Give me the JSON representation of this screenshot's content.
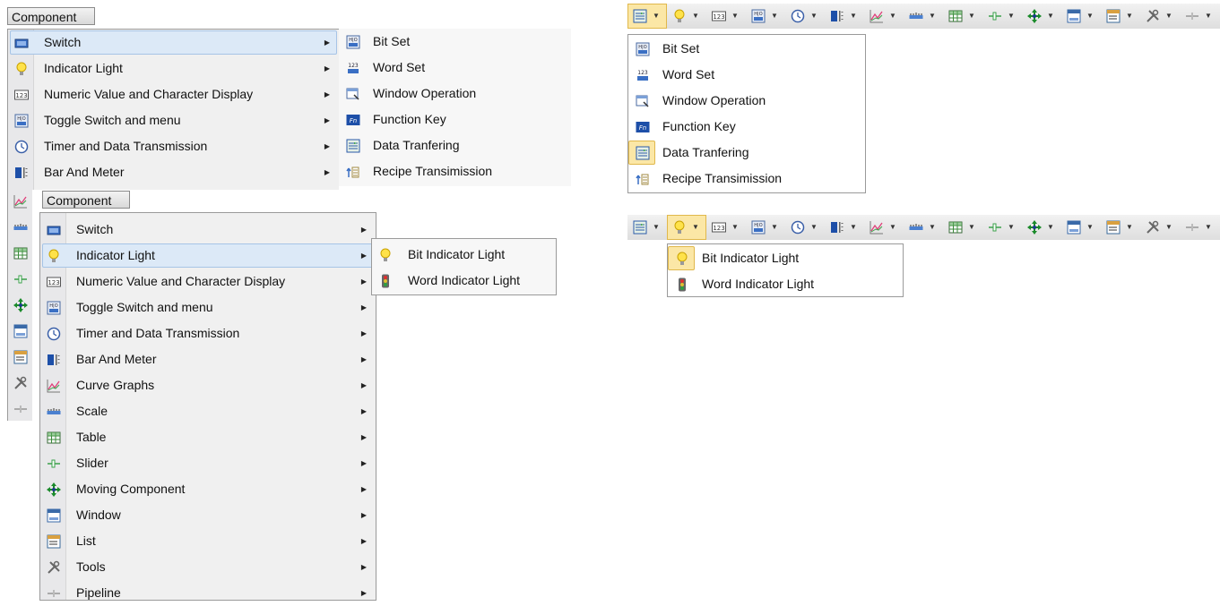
{
  "left_menu_1": {
    "title": "Component",
    "items": [
      {
        "label": "Switch",
        "icon": "switch-icon"
      },
      {
        "label": "Indicator Light",
        "icon": "bulb-icon"
      },
      {
        "label": "Numeric Value and Character Display",
        "icon": "numeric-icon"
      },
      {
        "label": "Toggle Switch and menu",
        "icon": "toggle-icon"
      },
      {
        "label": "Timer and Data Transmission",
        "icon": "clock-icon"
      },
      {
        "label": "Bar And Meter",
        "icon": "bar-meter-icon"
      }
    ],
    "gutter_icons_extra": [
      "curve-icon",
      "scale-icon",
      "table-icon",
      "slider-icon",
      "moving-icon",
      "window-icon",
      "list-icon",
      "tools-icon",
      "pipeline-icon"
    ],
    "submenu": [
      {
        "label": "Bit Set",
        "icon": "bitset-icon"
      },
      {
        "label": "Word Set",
        "icon": "wordset-icon"
      },
      {
        "label": "Window Operation",
        "icon": "window-op-icon"
      },
      {
        "label": "Function Key",
        "icon": "function-key-icon"
      },
      {
        "label": "Data Tranfering",
        "icon": "data-transfer-icon"
      },
      {
        "label": "Recipe Transimission",
        "icon": "recipe-icon"
      }
    ]
  },
  "left_menu_2": {
    "title": "Component",
    "items": [
      {
        "label": "Switch",
        "icon": "switch-icon"
      },
      {
        "label": "Indicator Light",
        "icon": "bulb-icon"
      },
      {
        "label": "Numeric Value and Character Display",
        "icon": "numeric-icon"
      },
      {
        "label": "Toggle Switch and menu",
        "icon": "toggle-icon"
      },
      {
        "label": "Timer and Data Transmission",
        "icon": "clock-icon"
      },
      {
        "label": "Bar And Meter",
        "icon": "bar-meter-icon"
      },
      {
        "label": "Curve Graphs",
        "icon": "curve-icon"
      },
      {
        "label": "Scale",
        "icon": "scale-icon"
      },
      {
        "label": "Table",
        "icon": "table-icon"
      },
      {
        "label": "Slider",
        "icon": "slider-icon"
      },
      {
        "label": "Moving Component",
        "icon": "moving-icon"
      },
      {
        "label": "Window",
        "icon": "window-icon"
      },
      {
        "label": "List",
        "icon": "list-icon"
      },
      {
        "label": "Tools",
        "icon": "tools-icon"
      },
      {
        "label": "Pipeline",
        "icon": "pipeline-icon"
      }
    ],
    "submenu": [
      {
        "label": "Bit Indicator Light",
        "icon": "bulb-icon"
      },
      {
        "label": "Word Indicator Light",
        "icon": "traffic-light-icon"
      }
    ]
  },
  "right_toolbar_1": {
    "buttons": [
      "data-transfer-icon",
      "bulb-icon",
      "numeric-icon",
      "toggle-icon",
      "clock-icon",
      "bar-meter-icon",
      "curve-icon",
      "scale-icon",
      "table-icon",
      "slider-icon",
      "moving-icon",
      "window-icon",
      "list-icon",
      "tools-icon",
      "pipeline-icon"
    ],
    "dropdown": [
      {
        "label": "Bit Set",
        "icon": "bitset-icon"
      },
      {
        "label": "Word Set",
        "icon": "wordset-icon"
      },
      {
        "label": "Window Operation",
        "icon": "window-op-icon"
      },
      {
        "label": "Function Key",
        "icon": "function-key-icon"
      },
      {
        "label": "Data Tranfering",
        "icon": "data-transfer-icon"
      },
      {
        "label": "Recipe Transimission",
        "icon": "recipe-icon"
      }
    ]
  },
  "right_toolbar_2": {
    "buttons": [
      "data-transfer-icon",
      "bulb-icon",
      "numeric-icon",
      "toggle-icon",
      "clock-icon",
      "bar-meter-icon",
      "curve-icon",
      "scale-icon",
      "table-icon",
      "slider-icon",
      "moving-icon",
      "window-icon",
      "list-icon",
      "tools-icon",
      "pipeline-icon"
    ],
    "dropdown": [
      {
        "label": "Bit Indicator Light",
        "icon": "bulb-icon"
      },
      {
        "label": "Word Indicator Light",
        "icon": "traffic-light-icon"
      }
    ]
  },
  "colors": {
    "highlight": "#dce9f7",
    "toolbar_selected": "#fbe7a6",
    "menu_bg": "#f0f0f0"
  }
}
